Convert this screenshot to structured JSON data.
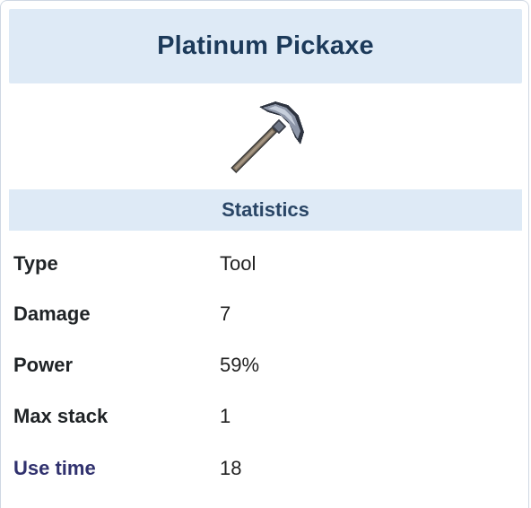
{
  "item": {
    "title": "Platinum Pickaxe",
    "image_icon": "pickaxe-icon"
  },
  "statistics": {
    "heading": "Statistics",
    "rows": [
      {
        "label": "Type",
        "value": "Tool"
      },
      {
        "label": "Damage",
        "value": "7"
      },
      {
        "label": "Power",
        "value": "59%"
      },
      {
        "label": "Max stack",
        "value": "1"
      },
      {
        "label": "Use time",
        "value": "18"
      }
    ]
  },
  "colors": {
    "header_bg": "#deeaf6",
    "title_text": "#1c3a5a",
    "link_label": "#30316e"
  }
}
